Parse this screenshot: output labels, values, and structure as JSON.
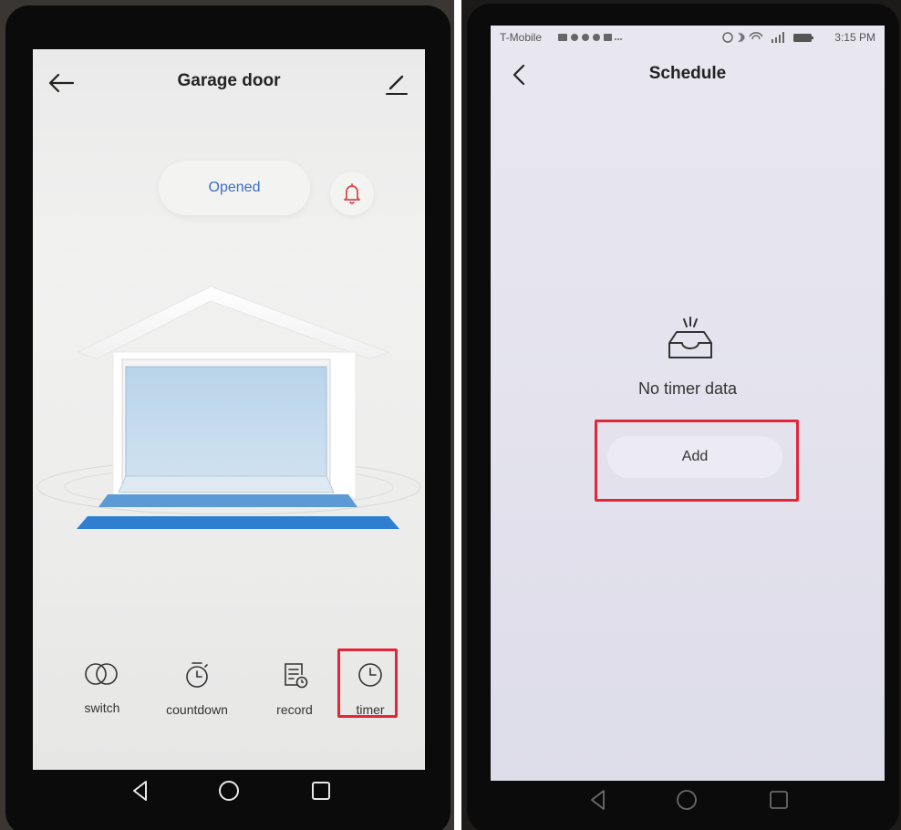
{
  "left_screen": {
    "title": "Garage door",
    "status_label": "Opened",
    "functions": [
      {
        "label": "switch"
      },
      {
        "label": "countdown"
      },
      {
        "label": "record"
      },
      {
        "label": "timer"
      }
    ],
    "highlighted_function": "timer"
  },
  "right_screen": {
    "status_bar": {
      "carrier": "T-Mobile",
      "time": "3:15 PM"
    },
    "title": "Schedule",
    "empty_message": "No timer data",
    "add_button_label": "Add"
  },
  "colors": {
    "accent_blue": "#3a6fc4",
    "alert_red": "#d94a4a",
    "highlight_red": "#e3263a",
    "garage_blue": "#2f7fd1"
  },
  "icons": {
    "left_back": "arrow-left-icon",
    "edit": "pencil-icon",
    "bell": "bell-icon",
    "switch": "switch-icon",
    "countdown": "stopwatch-icon",
    "record": "record-list-icon",
    "timer": "clock-icon",
    "right_back": "chevron-left-icon",
    "empty": "empty-tray-icon",
    "nav_back": "triangle-back-icon",
    "nav_home": "circle-home-icon",
    "nav_recent": "square-recent-icon"
  }
}
